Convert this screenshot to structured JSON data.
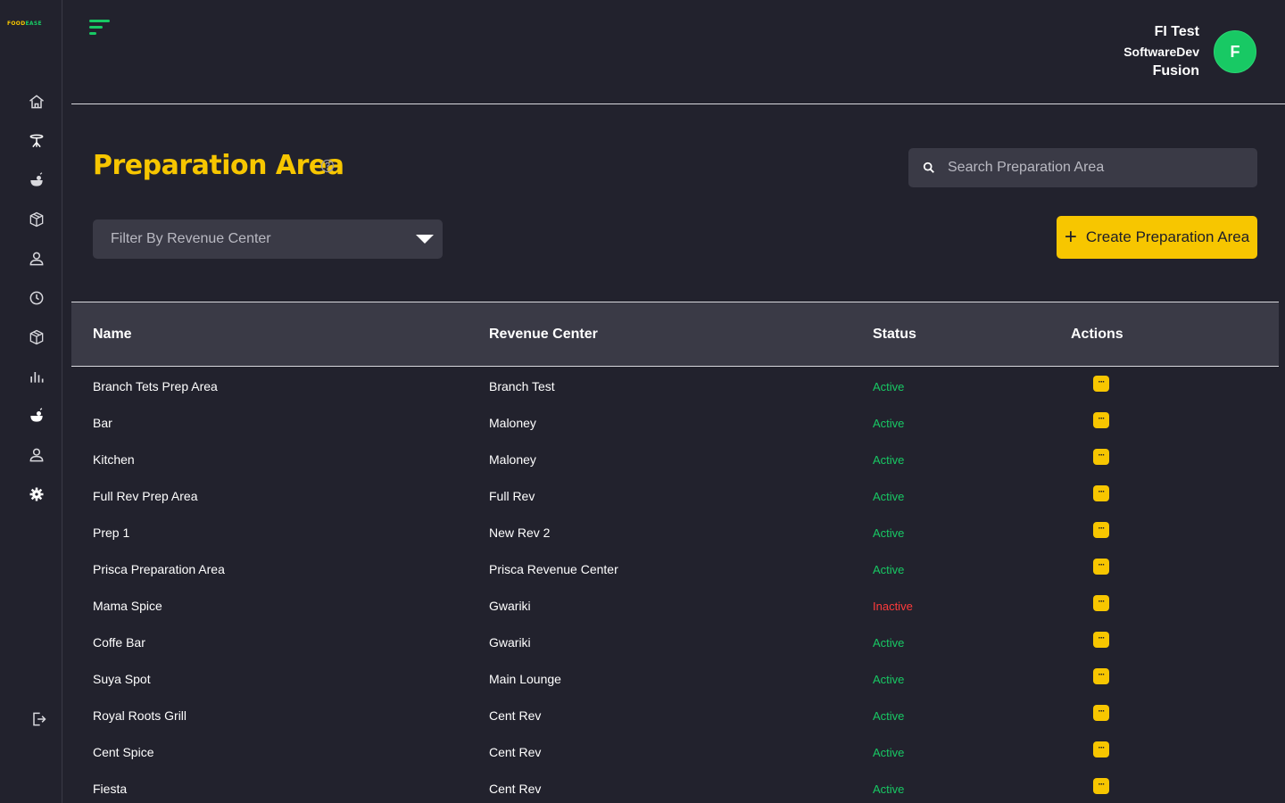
{
  "app": {
    "logo_part1": "FOOD",
    "logo_part2": "EASE"
  },
  "colors": {
    "accent": "#f7c600",
    "active": "#18c964",
    "inactive": "#ff3b3b",
    "background": "#22222d",
    "surface": "#3a3a46"
  },
  "sidebar": {
    "items": [
      {
        "icon": "home-icon"
      },
      {
        "icon": "table-icon"
      },
      {
        "icon": "food-icon"
      },
      {
        "icon": "box-icon"
      },
      {
        "icon": "user-icon"
      },
      {
        "icon": "clock-icon"
      },
      {
        "icon": "package-icon"
      },
      {
        "icon": "chart-icon"
      },
      {
        "icon": "grocery-icon"
      },
      {
        "icon": "staff-icon"
      },
      {
        "icon": "settings-icon"
      }
    ],
    "logout_icon": "logout-icon"
  },
  "header": {
    "user_name": "FI Test",
    "user_org": "SoftwareDev",
    "user_sub": "Fusion",
    "avatar_initial": "F"
  },
  "page": {
    "title": "Preparation Area",
    "search_placeholder": "Search Preparation Area",
    "filter_label": "Filter By Revenue Center",
    "create_label": "Create Preparation Area"
  },
  "table": {
    "columns": [
      "Name",
      "Revenue Center",
      "Status",
      "Actions"
    ],
    "action_glyph": "···",
    "rows": [
      {
        "name": "Branch Tets Prep Area",
        "revenue_center": "Branch Test",
        "status": "Active"
      },
      {
        "name": "Bar",
        "revenue_center": "Maloney",
        "status": "Active"
      },
      {
        "name": "Kitchen",
        "revenue_center": "Maloney",
        "status": "Active"
      },
      {
        "name": "Full Rev Prep Area",
        "revenue_center": "Full Rev",
        "status": "Active"
      },
      {
        "name": "Prep 1",
        "revenue_center": "New Rev 2",
        "status": "Active"
      },
      {
        "name": "Prisca Preparation Area",
        "revenue_center": "Prisca Revenue Center",
        "status": "Active"
      },
      {
        "name": "Mama Spice",
        "revenue_center": "Gwariki",
        "status": "Inactive"
      },
      {
        "name": "Coffe Bar",
        "revenue_center": "Gwariki",
        "status": "Active"
      },
      {
        "name": "Suya Spot",
        "revenue_center": "Main Lounge",
        "status": "Active"
      },
      {
        "name": "Royal Roots Grill",
        "revenue_center": "Cent Rev",
        "status": "Active"
      },
      {
        "name": "Cent Spice",
        "revenue_center": "Cent Rev",
        "status": "Active"
      },
      {
        "name": "Fiesta",
        "revenue_center": "Cent Rev",
        "status": "Active"
      }
    ]
  }
}
